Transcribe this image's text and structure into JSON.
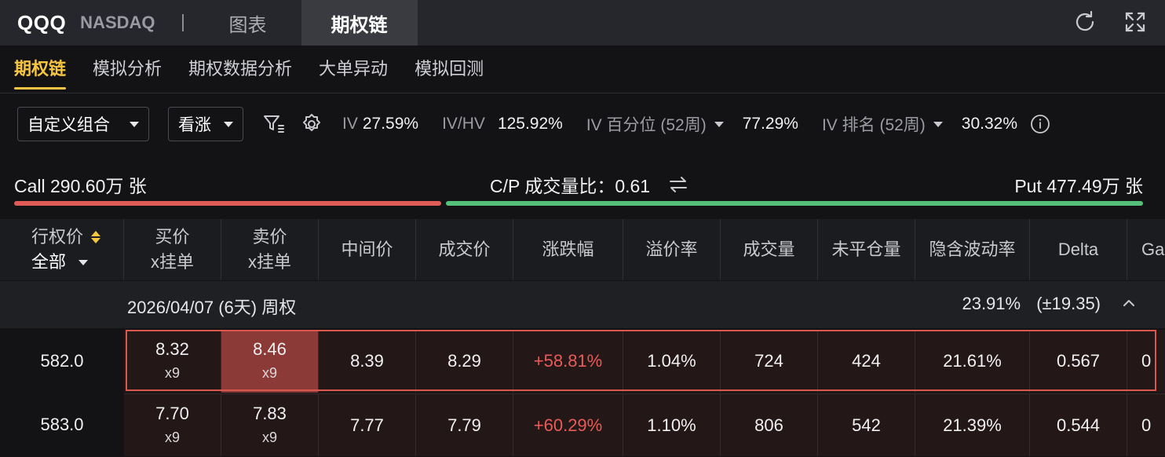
{
  "header": {
    "ticker": "QQQ",
    "exchange": "NASDAQ",
    "tabs": [
      {
        "label": "图表"
      },
      {
        "label": "期权链"
      }
    ]
  },
  "subnav": {
    "items": [
      {
        "label": "期权链",
        "active": true
      },
      {
        "label": "模拟分析"
      },
      {
        "label": "期权数据分析"
      },
      {
        "label": "大单异动"
      },
      {
        "label": "模拟回测"
      }
    ]
  },
  "filters": {
    "strategy": "自定义组合",
    "direction": "看涨",
    "iv_label": "IV",
    "iv_value": "27.59%",
    "ivhv_label": "IV/HV",
    "ivhv_value": "125.92%",
    "ivpct_label": "IV 百分位 (52周)",
    "ivpct_value": "77.29%",
    "ivrank_label": "IV 排名 (52周)",
    "ivrank_value": "30.32%"
  },
  "cp": {
    "call_label": "Call 290.60万 张",
    "ratio_label": "C/P 成交量比：0.61",
    "put_label": "Put 477.49万 张",
    "call_color": "#e15b57",
    "put_color": "#55c07a"
  },
  "table": {
    "strike_header": "行权价",
    "strike_filter": "全部",
    "columns": [
      {
        "line1": "买价",
        "line2": "x挂单"
      },
      {
        "line1": "卖价",
        "line2": "x挂单"
      },
      {
        "line1": "中间价"
      },
      {
        "line1": "成交价"
      },
      {
        "line1": "涨跌幅"
      },
      {
        "line1": "溢价率"
      },
      {
        "line1": "成交量"
      },
      {
        "line1": "未平仓量"
      },
      {
        "line1": "隐含波动率"
      },
      {
        "line1": "Delta"
      },
      {
        "line1": "Ga"
      }
    ],
    "group": {
      "expiry": "2026/04/07 (6天) 周权",
      "iv": "23.91%",
      "move": "(±19.35)"
    },
    "rows": [
      {
        "strike": "582.0",
        "bid": "8.32",
        "bid_size": "x9",
        "ask": "8.46",
        "ask_size": "x9",
        "mid": "8.39",
        "last": "8.29",
        "change": "+58.81%",
        "premium": "1.04%",
        "volume": "724",
        "oi": "424",
        "iv": "21.61%",
        "delta": "0.567",
        "gamma": "0"
      },
      {
        "strike": "583.0",
        "bid": "7.70",
        "bid_size": "x9",
        "ask": "7.83",
        "ask_size": "x9",
        "mid": "7.77",
        "last": "7.79",
        "change": "+60.29%",
        "premium": "1.10%",
        "volume": "806",
        "oi": "542",
        "iv": "21.39%",
        "delta": "0.544",
        "gamma": "0"
      }
    ]
  }
}
